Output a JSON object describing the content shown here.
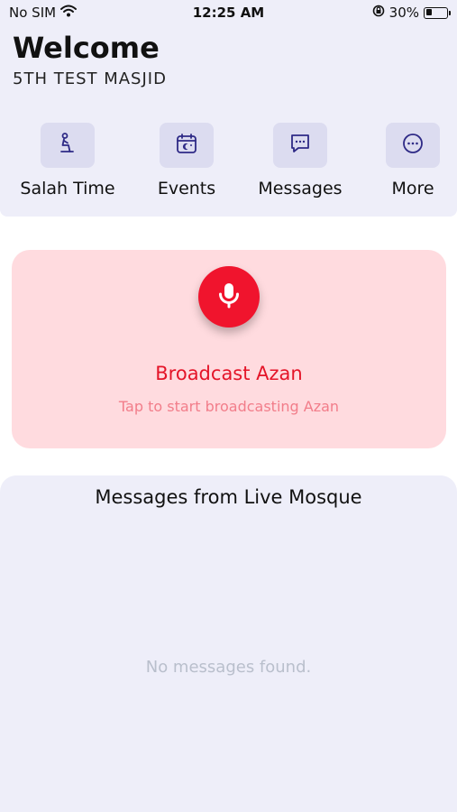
{
  "status_bar": {
    "carrier": "No SIM",
    "time": "12:25 AM",
    "battery_percent": "30%",
    "battery_level": 0.3,
    "icons": [
      "wifi-icon",
      "orientation-lock-icon",
      "battery-icon"
    ]
  },
  "header": {
    "title": "Welcome",
    "masjid_name": "5TH TEST MASJID"
  },
  "quick_actions": [
    {
      "label": "Salah Time",
      "icon": "prayer-person-icon"
    },
    {
      "label": "Events",
      "icon": "calendar-icon"
    },
    {
      "label": "Messages",
      "icon": "chat-bubble-icon"
    },
    {
      "label": "More",
      "icon": "more-dots-icon"
    }
  ],
  "broadcast": {
    "title": "Broadcast Azan",
    "subtitle": "Tap to start broadcasting Azan",
    "icon": "microphone-icon"
  },
  "messages": {
    "title": "Messages from Live Mosque",
    "empty_text": "No messages found."
  },
  "colors": {
    "panel_bg": "#eeeef9",
    "tile_bg": "#dcdcf0",
    "icon_color": "#2e2a86",
    "broadcast_bg": "#ffdbdf",
    "accent_red": "#f0142d",
    "subtitle_pink": "#f27d8a",
    "empty_text": "#b9bfcc"
  }
}
